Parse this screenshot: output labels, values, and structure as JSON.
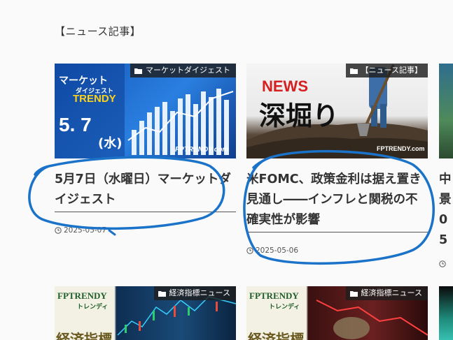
{
  "section_title": "【ニュース記事】",
  "cards": [
    {
      "category": "マーケットダイジェスト",
      "title": "5月7日（水曜日）マーケットダイジェスト",
      "date": "2025-05-07",
      "thumb": {
        "line1": "マーケット",
        "line2": "ダイジェスト",
        "line3": "TRENDY",
        "date_big": "5. 7",
        "weekday": "(水)",
        "brand": "FPTRENDY.com"
      }
    },
    {
      "category": "【ニュース記事】",
      "title": "米FOMC、政策金利は据え置き見通し――インフレと関税の不確実性が影響",
      "date": "2025-05-06",
      "thumb": {
        "news": "NEWS",
        "headline": "深堀り",
        "brand": "FPTRENDY.com"
      }
    },
    {
      "title_partial": "中景05"
    },
    {
      "category": "経済指標ニュース",
      "thumb": {
        "brand": "FPTRENDY",
        "sub": "トレンディ",
        "big": "経済指標"
      }
    },
    {
      "category": "経済指標ニュース",
      "thumb": {
        "brand": "FPTRENDY",
        "sub": "トレンディ",
        "big": "経済指標"
      }
    }
  ],
  "colors": {
    "annotation": "#1a73c8",
    "badge_bg": "#1e1e1e",
    "red_news": "#d62020"
  }
}
